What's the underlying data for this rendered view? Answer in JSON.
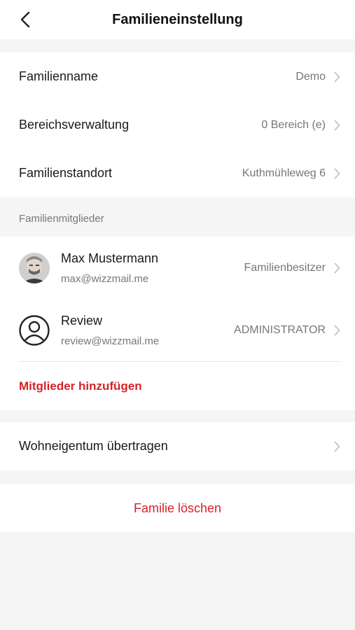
{
  "header": {
    "title": "Familieneinstellung",
    "back_icon": "chevron-left-icon"
  },
  "settings": {
    "family_name": {
      "label": "Familienname",
      "value": "Demo"
    },
    "area_management": {
      "label": "Bereichsverwaltung",
      "value": "0 Bereich (e)"
    },
    "family_location": {
      "label": "Familienstandort",
      "value": "Kuthmühleweg 6"
    }
  },
  "members_section": {
    "label": "Familienmitglieder",
    "members": [
      {
        "name": "Max Mustermann",
        "email": "max@wizzmail.me",
        "role": "Familienbesitzer",
        "avatar": "photo-avatar"
      },
      {
        "name": "Review",
        "email": "review@wizzmail.me",
        "role": "ADMINISTRATOR",
        "avatar": "user-outline-icon"
      }
    ],
    "add_label": "Mitglieder hinzufügen"
  },
  "transfer": {
    "label": "Wohneigentum übertragen"
  },
  "delete": {
    "label": "Familie löschen"
  },
  "colors": {
    "accent": "#d8232a",
    "background": "#f5f5f5",
    "card": "#ffffff"
  }
}
